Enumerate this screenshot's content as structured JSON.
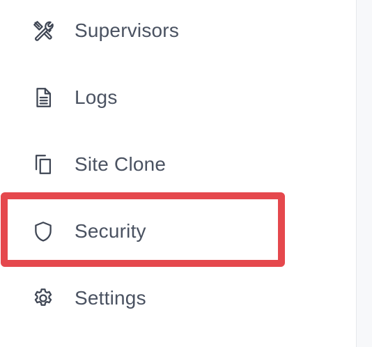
{
  "sidebar": {
    "items": [
      {
        "label": "Supervisors",
        "icon": "tools-icon"
      },
      {
        "label": "Logs",
        "icon": "document-icon"
      },
      {
        "label": "Site Clone",
        "icon": "copy-icon"
      },
      {
        "label": "Security",
        "icon": "shield-icon"
      },
      {
        "label": "Settings",
        "icon": "gear-icon"
      }
    ]
  },
  "colors": {
    "text": "#4a5261",
    "icon": "#3f4654",
    "highlight": "#e5484d"
  }
}
